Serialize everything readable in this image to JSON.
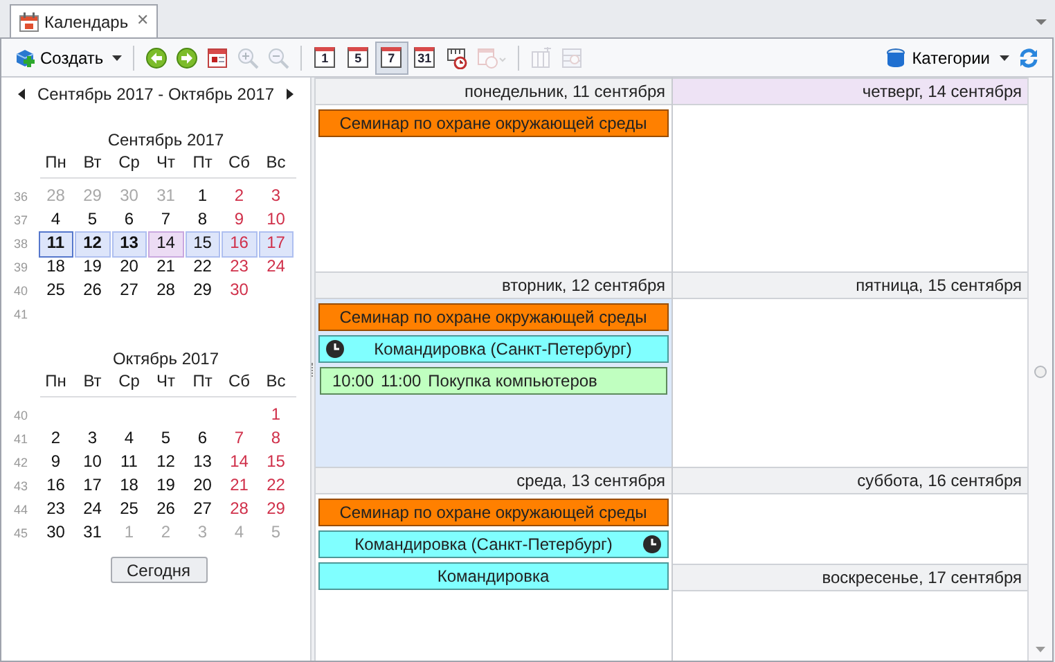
{
  "tab": {
    "title": "Календарь",
    "close": "✕"
  },
  "toolbar": [
    {
      "kind": "create",
      "label": "Создать",
      "disabled": false
    },
    {
      "kind": "separator"
    },
    {
      "kind": "back",
      "disabled": false
    },
    {
      "kind": "forward",
      "disabled": false
    },
    {
      "kind": "calendar",
      "disabled": false
    },
    {
      "kind": "zoom-in",
      "disabled": true
    },
    {
      "kind": "zoom-out",
      "disabled": true
    },
    {
      "kind": "separator"
    },
    {
      "kind": "view",
      "label": "1",
      "selected": false,
      "disabled": false
    },
    {
      "kind": "view",
      "label": "5",
      "selected": false,
      "disabled": false
    },
    {
      "kind": "view",
      "label": "7",
      "selected": true,
      "disabled": false
    },
    {
      "kind": "view",
      "label": "31",
      "selected": false,
      "disabled": false
    },
    {
      "kind": "timeline",
      "disabled": false
    },
    {
      "kind": "schedule",
      "disabled": true
    },
    {
      "kind": "separator"
    },
    {
      "kind": "columns",
      "disabled": true
    },
    {
      "kind": "group",
      "disabled": true
    }
  ],
  "categories": {
    "label": "Категории"
  },
  "navigator": {
    "range": "Сентябрь 2017 - Октябрь 2017",
    "today_button": "Сегодня"
  },
  "months": [
    {
      "title": "Сентябрь 2017",
      "weekdays": [
        "Пн",
        "Вт",
        "Ср",
        "Чт",
        "Пт",
        "Сб",
        "Вс"
      ],
      "weeks": [
        {
          "num": "36",
          "days": [
            {
              "d": "28",
              "muted": true,
              "selected": false,
              "today": false,
              "bold": false,
              "focused": false
            },
            {
              "d": "29",
              "muted": true,
              "selected": false,
              "today": false,
              "bold": false,
              "focused": false
            },
            {
              "d": "30",
              "muted": true,
              "selected": false,
              "today": false,
              "bold": false,
              "focused": false
            },
            {
              "d": "31",
              "muted": true,
              "selected": false,
              "today": false,
              "bold": false,
              "focused": false
            },
            {
              "d": "1",
              "muted": false,
              "selected": false,
              "today": false,
              "bold": false,
              "focused": false
            },
            {
              "d": "2",
              "muted": false,
              "selected": false,
              "today": false,
              "bold": false,
              "focused": false
            },
            {
              "d": "3",
              "muted": false,
              "selected": false,
              "today": false,
              "bold": false,
              "focused": false
            }
          ]
        },
        {
          "num": "37",
          "days": [
            {
              "d": "4",
              "muted": false,
              "selected": false,
              "today": false,
              "bold": false,
              "focused": false
            },
            {
              "d": "5",
              "muted": false,
              "selected": false,
              "today": false,
              "bold": false,
              "focused": false
            },
            {
              "d": "6",
              "muted": false,
              "selected": false,
              "today": false,
              "bold": false,
              "focused": false
            },
            {
              "d": "7",
              "muted": false,
              "selected": false,
              "today": false,
              "bold": false,
              "focused": false
            },
            {
              "d": "8",
              "muted": false,
              "selected": false,
              "today": false,
              "bold": false,
              "focused": false
            },
            {
              "d": "9",
              "muted": false,
              "selected": false,
              "today": false,
              "bold": false,
              "focused": false
            },
            {
              "d": "10",
              "muted": false,
              "selected": false,
              "today": false,
              "bold": false,
              "focused": false
            }
          ]
        },
        {
          "num": "38",
          "days": [
            {
              "d": "11",
              "muted": false,
              "selected": true,
              "today": false,
              "bold": true,
              "focused": true
            },
            {
              "d": "12",
              "muted": false,
              "selected": true,
              "today": false,
              "bold": true,
              "focused": false
            },
            {
              "d": "13",
              "muted": false,
              "selected": true,
              "today": false,
              "bold": true,
              "focused": false
            },
            {
              "d": "14",
              "muted": false,
              "selected": false,
              "today": true,
              "bold": false,
              "focused": false
            },
            {
              "d": "15",
              "muted": false,
              "selected": true,
              "today": false,
              "bold": false,
              "focused": false
            },
            {
              "d": "16",
              "muted": false,
              "selected": true,
              "today": false,
              "bold": false,
              "focused": false
            },
            {
              "d": "17",
              "muted": false,
              "selected": true,
              "today": false,
              "bold": false,
              "focused": false
            }
          ]
        },
        {
          "num": "39",
          "days": [
            {
              "d": "18",
              "muted": false,
              "selected": false,
              "today": false,
              "bold": false,
              "focused": false
            },
            {
              "d": "19",
              "muted": false,
              "selected": false,
              "today": false,
              "bold": false,
              "focused": false
            },
            {
              "d": "20",
              "muted": false,
              "selected": false,
              "today": false,
              "bold": false,
              "focused": false
            },
            {
              "d": "21",
              "muted": false,
              "selected": false,
              "today": false,
              "bold": false,
              "focused": false
            },
            {
              "d": "22",
              "muted": false,
              "selected": false,
              "today": false,
              "bold": false,
              "focused": false
            },
            {
              "d": "23",
              "muted": false,
              "selected": false,
              "today": false,
              "bold": false,
              "focused": false
            },
            {
              "d": "24",
              "muted": false,
              "selected": false,
              "today": false,
              "bold": false,
              "focused": false
            }
          ]
        },
        {
          "num": "40",
          "days": [
            {
              "d": "25",
              "muted": false,
              "selected": false,
              "today": false,
              "bold": false,
              "focused": false
            },
            {
              "d": "26",
              "muted": false,
              "selected": false,
              "today": false,
              "bold": false,
              "focused": false
            },
            {
              "d": "27",
              "muted": false,
              "selected": false,
              "today": false,
              "bold": false,
              "focused": false
            },
            {
              "d": "28",
              "muted": false,
              "selected": false,
              "today": false,
              "bold": false,
              "focused": false
            },
            {
              "d": "29",
              "muted": false,
              "selected": false,
              "today": false,
              "bold": false,
              "focused": false
            },
            {
              "d": "30",
              "muted": false,
              "selected": false,
              "today": false,
              "bold": false,
              "focused": false
            }
          ]
        },
        {
          "num": "41"
        }
      ]
    },
    {
      "title": "Октябрь 2017",
      "weekdays": [
        "Пн",
        "Вт",
        "Ср",
        "Чт",
        "Пт",
        "Сб",
        "Вс"
      ],
      "weeks": [
        {
          "num": "40",
          "days": [
            {
              "d": "1",
              "muted": false,
              "selected": false,
              "today": false,
              "bold": false,
              "focused": false
            }
          ],
          "align_end": true
        },
        {
          "num": "41",
          "days": [
            {
              "d": "2",
              "muted": false,
              "selected": false,
              "today": false,
              "bold": false,
              "focused": false
            },
            {
              "d": "3",
              "muted": false,
              "selected": false,
              "today": false,
              "bold": false,
              "focused": false
            },
            {
              "d": "4",
              "muted": false,
              "selected": false,
              "today": false,
              "bold": false,
              "focused": false
            },
            {
              "d": "5",
              "muted": false,
              "selected": false,
              "today": false,
              "bold": false,
              "focused": false
            },
            {
              "d": "6",
              "muted": false,
              "selected": false,
              "today": false,
              "bold": false,
              "focused": false
            },
            {
              "d": "7",
              "muted": false,
              "selected": false,
              "today": false,
              "bold": false,
              "focused": false
            },
            {
              "d": "8",
              "muted": false,
              "selected": false,
              "today": false,
              "bold": false,
              "focused": false
            }
          ]
        },
        {
          "num": "42",
          "days": [
            {
              "d": "9",
              "muted": false,
              "selected": false,
              "today": false,
              "bold": false,
              "focused": false
            },
            {
              "d": "10",
              "muted": false,
              "selected": false,
              "today": false,
              "bold": false,
              "focused": false
            },
            {
              "d": "11",
              "muted": false,
              "selected": false,
              "today": false,
              "bold": false,
              "focused": false
            },
            {
              "d": "12",
              "muted": false,
              "selected": false,
              "today": false,
              "bold": false,
              "focused": false
            },
            {
              "d": "13",
              "muted": false,
              "selected": false,
              "today": false,
              "bold": false,
              "focused": false
            },
            {
              "d": "14",
              "muted": false,
              "selected": false,
              "today": false,
              "bold": false,
              "focused": false
            },
            {
              "d": "15",
              "muted": false,
              "selected": false,
              "today": false,
              "bold": false,
              "focused": false
            }
          ]
        },
        {
          "num": "43",
          "days": [
            {
              "d": "16",
              "muted": false,
              "selected": false,
              "today": false,
              "bold": false,
              "focused": false
            },
            {
              "d": "17",
              "muted": false,
              "selected": false,
              "today": false,
              "bold": false,
              "focused": false
            },
            {
              "d": "18",
              "muted": false,
              "selected": false,
              "today": false,
              "bold": false,
              "focused": false
            },
            {
              "d": "19",
              "muted": false,
              "selected": false,
              "today": false,
              "bold": false,
              "focused": false
            },
            {
              "d": "20",
              "muted": false,
              "selected": false,
              "today": false,
              "bold": false,
              "focused": false
            },
            {
              "d": "21",
              "muted": false,
              "selected": false,
              "today": false,
              "bold": false,
              "focused": false
            },
            {
              "d": "22",
              "muted": false,
              "selected": false,
              "today": false,
              "bold": false,
              "focused": false
            }
          ]
        },
        {
          "num": "44",
          "days": [
            {
              "d": "23",
              "muted": false,
              "selected": false,
              "today": false,
              "bold": false,
              "focused": false
            },
            {
              "d": "24",
              "muted": false,
              "selected": false,
              "today": false,
              "bold": false,
              "focused": false
            },
            {
              "d": "25",
              "muted": false,
              "selected": false,
              "today": false,
              "bold": false,
              "focused": false
            },
            {
              "d": "26",
              "muted": false,
              "selected": false,
              "today": false,
              "bold": false,
              "focused": false
            },
            {
              "d": "27",
              "muted": false,
              "selected": false,
              "today": false,
              "bold": false,
              "focused": false
            },
            {
              "d": "28",
              "muted": false,
              "selected": false,
              "today": false,
              "bold": false,
              "focused": false
            },
            {
              "d": "29",
              "muted": false,
              "selected": false,
              "today": false,
              "bold": false,
              "focused": false
            }
          ]
        },
        {
          "num": "45",
          "days": [
            {
              "d": "30",
              "muted": false,
              "selected": false,
              "today": false,
              "bold": false,
              "focused": false
            },
            {
              "d": "31",
              "muted": false,
              "selected": false,
              "today": false,
              "bold": false,
              "focused": false
            },
            {
              "d": "1",
              "muted": true,
              "selected": false,
              "today": false,
              "bold": false,
              "focused": false
            },
            {
              "d": "2",
              "muted": true,
              "selected": false,
              "today": false,
              "bold": false,
              "focused": false
            },
            {
              "d": "3",
              "muted": true,
              "selected": false,
              "today": false,
              "bold": false,
              "focused": false
            },
            {
              "d": "4",
              "muted": true,
              "selected": false,
              "today": false,
              "bold": false,
              "focused": false
            },
            {
              "d": "5",
              "muted": true,
              "selected": false,
              "today": false,
              "bold": false,
              "focused": false
            }
          ]
        }
      ]
    }
  ],
  "week_view": {
    "columns": [
      {
        "days": [
          {
            "header": "понедельник, 11 сентября",
            "selected": false,
            "today": false,
            "events": [
              {
                "kind": "allday",
                "title": "Семинар по охране окружающей среды",
                "color": "#ff8000",
                "clock_left": false,
                "clock_right": false
              }
            ]
          },
          {
            "header": "вторник, 12 сентября",
            "selected": true,
            "today": false,
            "events": [
              {
                "kind": "allday",
                "title": "Семинар по охране окружающей среды",
                "color": "#ff8000",
                "clock_left": false,
                "clock_right": false
              },
              {
                "kind": "allday",
                "title": "Командировка (Санкт-Петербург)",
                "color": "#80ffff",
                "clock_left": true,
                "clock_right": false
              },
              {
                "kind": "timed",
                "start": "10:00",
                "end": "11:00",
                "title": "Покупка компьютеров",
                "color": "#c0ffc0"
              }
            ]
          },
          {
            "header": "среда, 13 сентября",
            "selected": false,
            "today": false,
            "events": [
              {
                "kind": "allday",
                "title": "Семинар по охране окружающей среды",
                "color": "#ff8000",
                "clock_left": false,
                "clock_right": false
              },
              {
                "kind": "allday",
                "title": "Командировка (Санкт-Петербург)",
                "color": "#80ffff",
                "clock_left": false,
                "clock_right": true
              },
              {
                "kind": "allday",
                "title": "Командировка",
                "color": "#80ffff",
                "clock_left": false,
                "clock_right": false
              }
            ]
          }
        ]
      },
      {
        "days": [
          {
            "header": "четверг, 14 сентября",
            "selected": false,
            "today": true,
            "half": false
          },
          {
            "header": "пятница, 15 сентября",
            "selected": false,
            "today": false,
            "half": false
          },
          {
            "header": "суббота, 16 сентября",
            "selected": false,
            "today": false,
            "half": true
          },
          {
            "header": "воскресенье, 17 сентября",
            "selected": false,
            "today": false,
            "half": true
          }
        ]
      }
    ]
  }
}
